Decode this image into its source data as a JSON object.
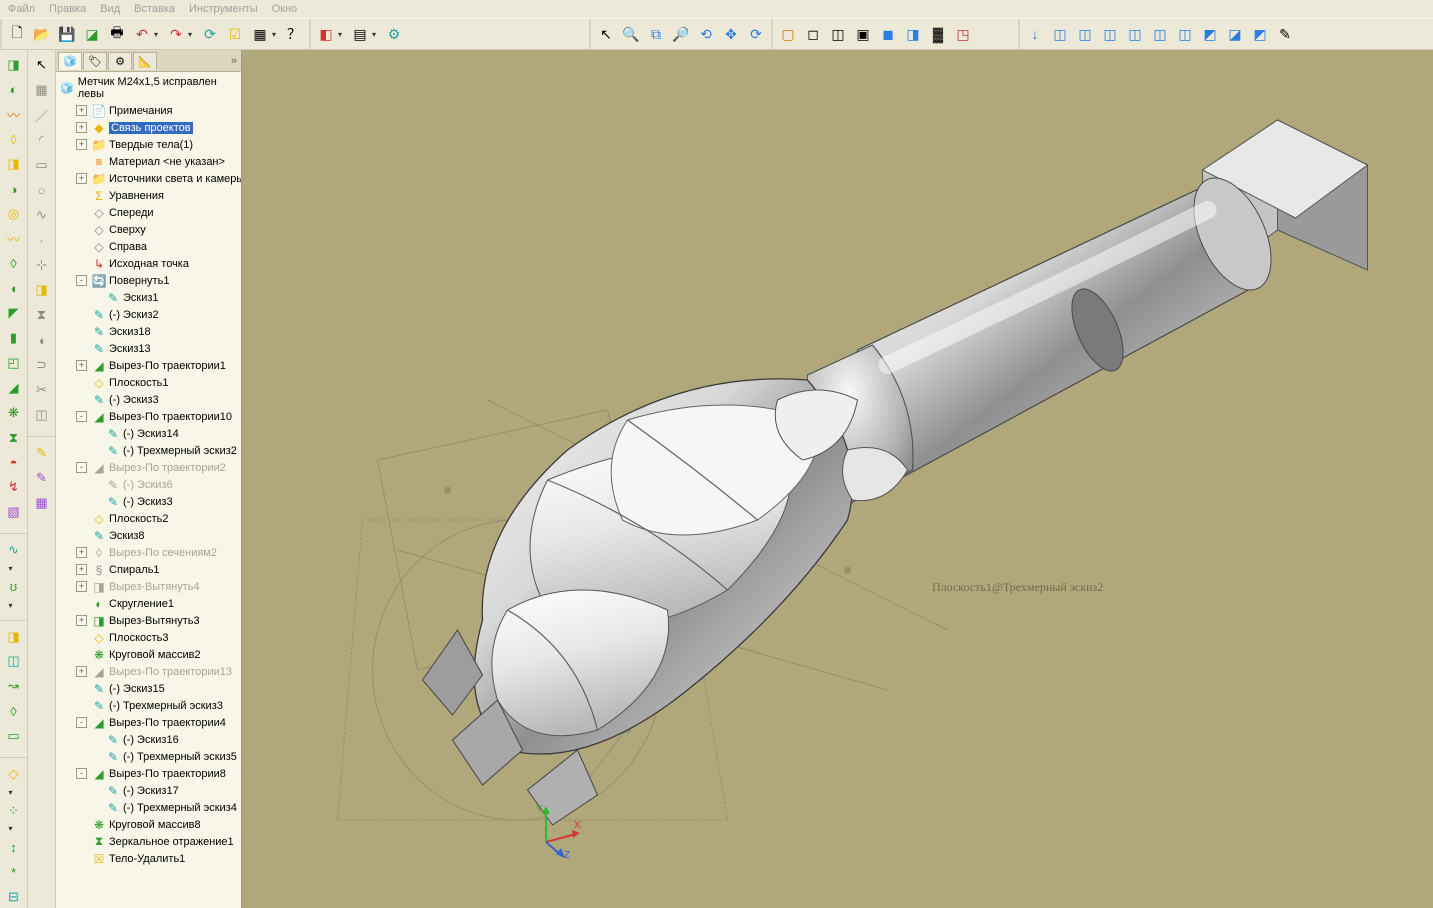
{
  "menubar": [
    "Файл",
    "Правка",
    "Вид",
    "Вставка",
    "Инструменты",
    "Окно"
  ],
  "tree": {
    "root": "Метчик М24x1,5 исправлен левы",
    "items": [
      {
        "depth": 1,
        "exp": "+",
        "icon": "📄",
        "iconCls": "ic-yellow",
        "label": "Примечания"
      },
      {
        "depth": 1,
        "exp": "+",
        "icon": "◆",
        "iconCls": "ic-yellow",
        "label": "Связь проектов",
        "selected": true
      },
      {
        "depth": 1,
        "exp": "+",
        "icon": "📁",
        "iconCls": "ic-folder",
        "label": "Твердые тела(1)"
      },
      {
        "depth": 1,
        "exp": "",
        "icon": "≡",
        "iconCls": "ic-orange",
        "label": "Материал <не указан>"
      },
      {
        "depth": 1,
        "exp": "+",
        "icon": "📁",
        "iconCls": "ic-folder",
        "label": "Источники света и камеры"
      },
      {
        "depth": 1,
        "exp": "",
        "icon": "Σ",
        "iconCls": "ic-yellow",
        "label": "Уравнения"
      },
      {
        "depth": 1,
        "exp": "",
        "icon": "◇",
        "iconCls": "ic-grey",
        "label": "Спереди"
      },
      {
        "depth": 1,
        "exp": "",
        "icon": "◇",
        "iconCls": "ic-grey",
        "label": "Сверху"
      },
      {
        "depth": 1,
        "exp": "",
        "icon": "◇",
        "iconCls": "ic-grey",
        "label": "Справа"
      },
      {
        "depth": 1,
        "exp": "",
        "icon": "↳",
        "iconCls": "ic-red",
        "label": "Исходная точка"
      },
      {
        "depth": 1,
        "exp": "-",
        "icon": "🔄",
        "iconCls": "ic-green",
        "label": "Повернуть1"
      },
      {
        "depth": 2,
        "exp": "",
        "icon": "✎",
        "iconCls": "ic-teal",
        "label": "Эскиз1"
      },
      {
        "depth": 1,
        "exp": "",
        "icon": "✎",
        "iconCls": "ic-teal",
        "label": "(-) Эскиз2"
      },
      {
        "depth": 1,
        "exp": "",
        "icon": "✎",
        "iconCls": "ic-teal",
        "label": "Эскиз18"
      },
      {
        "depth": 1,
        "exp": "",
        "icon": "✎",
        "iconCls": "ic-teal",
        "label": "Эскиз13"
      },
      {
        "depth": 1,
        "exp": "+",
        "icon": "◢",
        "iconCls": "ic-green",
        "label": "Вырез-По траектории1"
      },
      {
        "depth": 1,
        "exp": "",
        "icon": "◇",
        "iconCls": "ic-yellow",
        "label": "Плоскость1"
      },
      {
        "depth": 1,
        "exp": "",
        "icon": "✎",
        "iconCls": "ic-teal",
        "label": "(-) Эскиз3"
      },
      {
        "depth": 1,
        "exp": "-",
        "icon": "◢",
        "iconCls": "ic-green",
        "label": "Вырез-По траектории10"
      },
      {
        "depth": 2,
        "exp": "",
        "icon": "✎",
        "iconCls": "ic-teal",
        "label": "(-) Эскиз14"
      },
      {
        "depth": 2,
        "exp": "",
        "icon": "✎",
        "iconCls": "ic-teal",
        "label": "(-) Трехмерный эскиз2"
      },
      {
        "depth": 1,
        "exp": "-",
        "icon": "◢",
        "iconCls": "ic-grey",
        "label": "Вырез-По траектории2",
        "suppressed": true
      },
      {
        "depth": 2,
        "exp": "",
        "icon": "✎",
        "iconCls": "ic-grey",
        "label": "(-) Эскиз6",
        "suppressed": true
      },
      {
        "depth": 2,
        "exp": "",
        "icon": "✎",
        "iconCls": "ic-teal",
        "label": "(-) Эскиз3"
      },
      {
        "depth": 1,
        "exp": "",
        "icon": "◇",
        "iconCls": "ic-yellow",
        "label": "Плоскость2"
      },
      {
        "depth": 1,
        "exp": "",
        "icon": "✎",
        "iconCls": "ic-teal",
        "label": "Эскиз8"
      },
      {
        "depth": 1,
        "exp": "+",
        "icon": "◊",
        "iconCls": "ic-grey",
        "label": "Вырез-По сечениям2",
        "suppressed": true
      },
      {
        "depth": 1,
        "exp": "+",
        "icon": "§",
        "iconCls": "ic-grey",
        "label": "Спираль1"
      },
      {
        "depth": 1,
        "exp": "+",
        "icon": "◨",
        "iconCls": "ic-grey",
        "label": "Вырез-Вытянуть4",
        "suppressed": true
      },
      {
        "depth": 1,
        "exp": "",
        "icon": "◐",
        "iconCls": "ic-green",
        "label": "Скругление1"
      },
      {
        "depth": 1,
        "exp": "+",
        "icon": "◨",
        "iconCls": "ic-green",
        "label": "Вырез-Вытянуть3"
      },
      {
        "depth": 1,
        "exp": "",
        "icon": "◇",
        "iconCls": "ic-yellow",
        "label": "Плоскость3"
      },
      {
        "depth": 1,
        "exp": "",
        "icon": "❋",
        "iconCls": "ic-green",
        "label": "Круговой массив2"
      },
      {
        "depth": 1,
        "exp": "+",
        "icon": "◢",
        "iconCls": "ic-grey",
        "label": "Вырез-По траектории13",
        "suppressed": true
      },
      {
        "depth": 1,
        "exp": "",
        "icon": "✎",
        "iconCls": "ic-teal",
        "label": "(-) Эскиз15"
      },
      {
        "depth": 1,
        "exp": "",
        "icon": "✎",
        "iconCls": "ic-teal",
        "label": "(-) Трехмерный эскиз3"
      },
      {
        "depth": 1,
        "exp": "-",
        "icon": "◢",
        "iconCls": "ic-green",
        "label": "Вырез-По траектории4"
      },
      {
        "depth": 2,
        "exp": "",
        "icon": "✎",
        "iconCls": "ic-teal",
        "label": "(-) Эскиз16"
      },
      {
        "depth": 2,
        "exp": "",
        "icon": "✎",
        "iconCls": "ic-teal",
        "label": "(-) Трехмерный эскиз5"
      },
      {
        "depth": 1,
        "exp": "-",
        "icon": "◢",
        "iconCls": "ic-green",
        "label": "Вырез-По траектории8"
      },
      {
        "depth": 2,
        "exp": "",
        "icon": "✎",
        "iconCls": "ic-teal",
        "label": "(-) Эскиз17"
      },
      {
        "depth": 2,
        "exp": "",
        "icon": "✎",
        "iconCls": "ic-teal",
        "label": "(-) Трехмерный эскиз4"
      },
      {
        "depth": 1,
        "exp": "",
        "icon": "❋",
        "iconCls": "ic-green",
        "label": "Круговой массив8"
      },
      {
        "depth": 1,
        "exp": "",
        "icon": "⧗",
        "iconCls": "ic-green",
        "label": "Зеркальное отражение1"
      },
      {
        "depth": 1,
        "exp": "",
        "icon": "☒",
        "iconCls": "ic-yellow",
        "label": "Тело-Удалить1"
      }
    ]
  },
  "viewport": {
    "annotation": "Плоскость1@Трехмерный эскиз2"
  },
  "triad": {
    "x": "X",
    "y": "Y",
    "z": "Z"
  }
}
